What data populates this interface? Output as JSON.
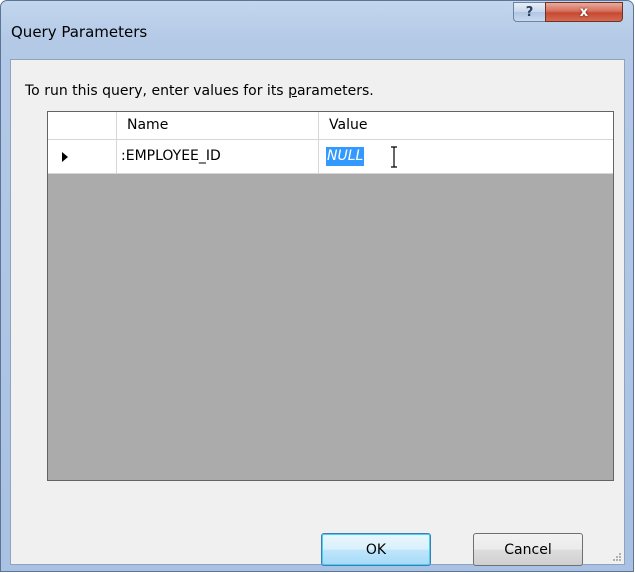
{
  "window": {
    "title": "Query Parameters",
    "help_glyph": "?",
    "close_glyph": "x"
  },
  "instruction": {
    "before": "To run this query, enter values for its ",
    "underlined": "p",
    "after": "arameters."
  },
  "grid": {
    "columns": [
      "Name",
      "Value"
    ],
    "rows": [
      {
        "name": ":EMPLOYEE_ID",
        "value": "NULL",
        "value_selected": true
      }
    ]
  },
  "buttons": {
    "ok": "OK",
    "cancel": "Cancel"
  },
  "colors": {
    "selection": "#3399ff",
    "grid_empty": "#ababab",
    "close_button": "#c74a32"
  }
}
